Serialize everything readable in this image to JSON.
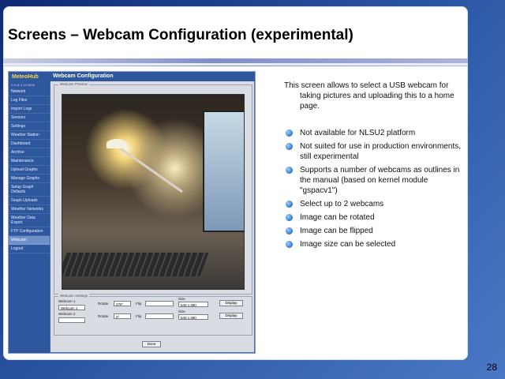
{
  "slide": {
    "title": "Screens – Webcam Configuration (experimental)",
    "description": "This screen allows to select a USB webcam for taking pictures and uploading this to a home page.",
    "bullets": [
      "Not available for NLSU2 platform",
      "Not suited for use in production environments, still experimental",
      "Supports a number of webcams as outlines in the manual (based on kernel module \"gspacv1\")",
      "Select up to 2 webcams",
      "Image can be rotated",
      "Image can be flipped",
      "Image size can be selected"
    ],
    "page_number": "28"
  },
  "app": {
    "brand": "MeteoHub",
    "version": "2.6 v1.2 12.2006",
    "header": "Webcam Configuration",
    "nav": [
      "Network",
      "Log Files",
      "Import Logs",
      "Sensors",
      "Settings",
      "Weather Station",
      "Dashboard",
      "Archive",
      "Maintenance",
      "Upload Graphs",
      "Manage Graphs",
      "Setup Graph Defaults",
      "Graph Uploads",
      "Weather Networks",
      "Weather Data Export",
      "FTP Configuration",
      "Webcam",
      "Logout"
    ],
    "active_nav_index": 16,
    "preview_legend": "Webcam Preview",
    "settings_legend": "Webcam Settings",
    "webcam1_label": "Webcam 1",
    "webcam1_value": "Webcam 1",
    "webcam2_label": "Webcam 2",
    "webcam2_value": "",
    "rotate_label": "Rotate",
    "rotate1_value": "270°",
    "rotate2_label": "Rotate",
    "rotate2_value": "0°",
    "flip_label": "Flip",
    "flip1_value": "",
    "flip2_label": "Flip",
    "flip2_value": "",
    "size_label": "Size",
    "size1_value": "640 x 480",
    "size2_label": "Size",
    "size2_value": "640 x 480",
    "display_label": "Display",
    "display2_label": "Display",
    "done_label": "Done"
  }
}
